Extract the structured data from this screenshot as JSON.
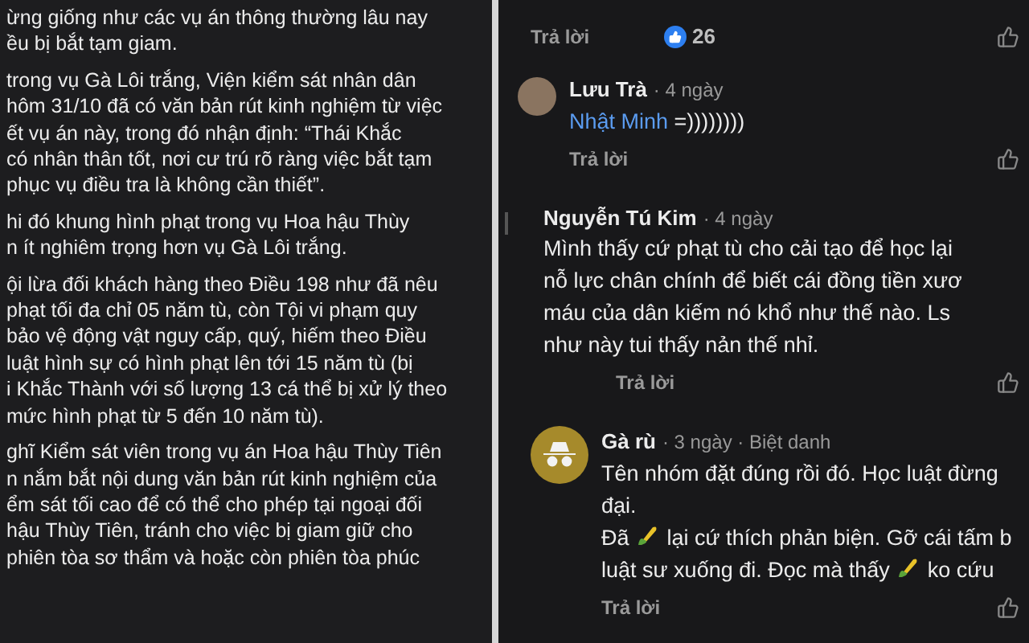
{
  "article": {
    "paragraphs": [
      [
        "ừng giống như các vụ án thông thường lâu nay",
        "ều bị bắt tạm giam."
      ],
      [
        "trong vụ Gà Lôi trắng, Viện kiểm sát nhân dân",
        "hôm 31/10 đã có văn bản rút kinh nghiệm từ việc",
        "ết vụ án này, trong đó nhận định: “Thái Khắc",
        "có nhân thân tốt, nơi cư trú rõ ràng việc bắt tạm",
        "phục vụ điều tra là không cần thiết”."
      ],
      [
        "hi đó khung hình phạt trong vụ Hoa hậu Thùy",
        "n ít nghiêm trọng hơn vụ Gà Lôi trắng."
      ],
      [
        "ội lừa đối khách hàng theo Điều 198 như đã nêu",
        "phạt tối đa chỉ 05 năm tù, còn Tội vi phạm quy",
        "bảo vệ động vật nguy cấp, quý, hiếm theo Điều",
        "luật hình sự có hình phạt lên tới 15 năm tù (bị",
        "i Khắc Thành với số lượng 13 cá thể bị xử lý theo",
        "mức hình phạt từ 5 đến 10 năm tù)."
      ],
      [
        "ghĩ Kiểm sát viên trong vụ án Hoa hậu Thùy Tiên",
        "n nắm bắt nội dung văn bản rút kinh nghiệm của",
        "ểm sát tối cao để có thể cho phép tại ngoại đối",
        "hậu Thùy Tiên, tránh cho việc bị giam giữ cho",
        "phiên tòa sơ thẩm và hoặc còn phiên tòa phúc"
      ]
    ]
  },
  "comments_panel": {
    "top_actions": {
      "reply": "Trả lời",
      "like_count": "26"
    },
    "comments": [
      {
        "kind": "photo",
        "author": "Lưu Trà",
        "meta": "· 4 ngày",
        "lines": [
          [
            {
              "kind": "mention",
              "text": "Nhật Minh"
            },
            {
              "kind": "text",
              "text": " =))))))))"
            }
          ]
        ],
        "reply": "Trả lời"
      },
      {
        "kind": "thread",
        "author": "Nguyễn Tú Kim",
        "meta": "· 4 ngày",
        "lines": [
          [
            {
              "kind": "text",
              "text": "Mình thấy cứ phạt tù cho cải tạo để học lại"
            }
          ],
          [
            {
              "kind": "text",
              "text": "nỗ lực chân chính để biết cái đồng tiền xươ"
            }
          ],
          [
            {
              "kind": "text",
              "text": "máu của dân kiếm nó khổ như thế nào. Ls"
            }
          ],
          [
            {
              "kind": "text",
              "text": "như này tui thấy nản thế nhỉ."
            }
          ]
        ],
        "reply": "Trả lời"
      },
      {
        "kind": "anonymous",
        "author": "Gà rù",
        "meta": "· 3 ngày · Biệt danh",
        "lines": [
          [
            {
              "kind": "text",
              "text": "Tên nhóm đặt đúng rồi đó. Học luật đừng"
            }
          ],
          [
            {
              "kind": "text",
              "text": "đại."
            }
          ],
          [
            {
              "kind": "text",
              "text": "Đã "
            },
            {
              "kind": "emoji"
            },
            {
              "kind": "text",
              "text": " lại cứ thích phản biện. Gỡ cái tấm b"
            }
          ],
          [
            {
              "kind": "text",
              "text": "luật sư xuống đi. Đọc mà thấy "
            },
            {
              "kind": "emoji"
            },
            {
              "kind": "text",
              "text": " ko cứu"
            }
          ]
        ],
        "reply": "Trả lời"
      }
    ]
  }
}
